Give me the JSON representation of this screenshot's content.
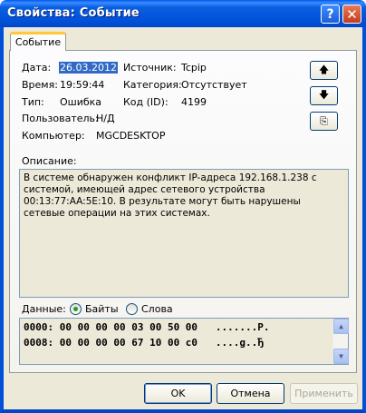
{
  "window": {
    "title": "Свойства: Событие",
    "help_label": "?",
    "close_label": "✕"
  },
  "tab": {
    "label": "Событие"
  },
  "fields": {
    "date_label": "Дата:",
    "date_value": "26.03.2012",
    "source_label": "Источник:",
    "source_value": "Tcpip",
    "time_label": "Время:",
    "time_value": "19:59:44",
    "category_label": "Категория:",
    "category_value": "Отсутствует",
    "type_label": "Тип:",
    "type_value": "Ошибка",
    "code_label": "Код (ID):",
    "code_value": "4199",
    "user_label": "Пользователь:",
    "user_value": "Н/Д",
    "computer_label": "Компьютер:",
    "computer_value": "MGCDESKTOP"
  },
  "side_buttons": {
    "up": "🡅",
    "down": "🡇",
    "copy": "⎘"
  },
  "description": {
    "label": "Описание:",
    "text": "В системе обнаружен конфликт IP-адреса 192.168.1.238 с системой, имеющей  адрес сетевого устройства 00:13:77:AA:5E:10. В результате могут быть нарушены  сетевые операции на этих системах."
  },
  "data": {
    "label": "Данные:",
    "bytes_label": "Байты",
    "words_label": "Слова",
    "selected": "bytes",
    "lines": [
      "0000: 00 00 00 00 03 00 50 00   .......P.",
      "0008: 00 00 00 00 67 10 00 c0   ....g..Ђ"
    ]
  },
  "buttons": {
    "ok": "OK",
    "cancel": "Отмена",
    "apply": "Применить"
  }
}
